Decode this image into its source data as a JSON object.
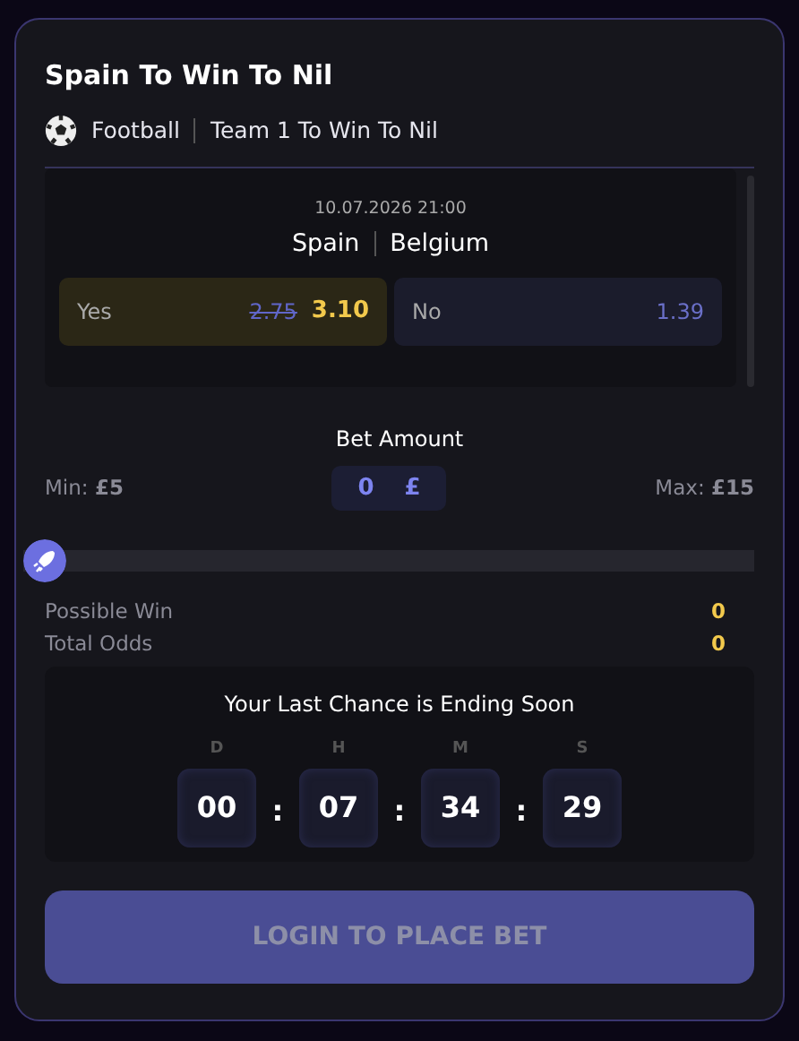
{
  "title": "Spain To Win To Nil",
  "sport": "Football",
  "market": "Team 1 To Win To Nil",
  "match": {
    "datetime": "10.07.2026 21:00",
    "home": "Spain",
    "away": "Belgium",
    "outcomes": [
      {
        "label": "Yes",
        "old_odds": "2.75",
        "odds": "3.10",
        "selected": true
      },
      {
        "label": "No",
        "odds": "1.39",
        "selected": false
      }
    ]
  },
  "bet": {
    "label": "Bet Amount",
    "min_label": "Min:",
    "min": "£5",
    "max_label": "Max:",
    "max": "£15",
    "value": "0",
    "currency": "£",
    "level": 0
  },
  "summary": [
    {
      "label": "Possible Win",
      "value": "0"
    },
    {
      "label": "Total Odds",
      "value": "0"
    }
  ],
  "countdown": {
    "title": "Your Last Chance is Ending Soon",
    "units": [
      {
        "label": "D",
        "value": "00"
      },
      {
        "label": "H",
        "value": "07"
      },
      {
        "label": "M",
        "value": "34"
      },
      {
        "label": "S",
        "value": "29"
      }
    ],
    "separator": ":"
  },
  "button": {
    "label": "LOGIN TO PLACE BET",
    "disabled": true
  }
}
